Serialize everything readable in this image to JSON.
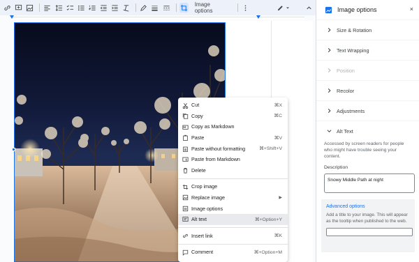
{
  "toolbar": {
    "icons": [
      "link-icon",
      "comment-add-icon",
      "image-icon",
      "align-left-icon",
      "line-spacing-icon",
      "checklist-icon",
      "bullet-list-icon",
      "numbered-list-icon",
      "decrease-indent-icon",
      "increase-indent-icon",
      "clear-format-icon",
      "pen-color-icon",
      "border-weight-icon",
      "border-dash-icon",
      "crop-icon",
      "more-icon",
      "edit-mode-icon",
      "collapse-icon"
    ],
    "image_options_label": "Image options"
  },
  "context_menu": {
    "groups": [
      [
        {
          "label": "Cut",
          "shortcut": "⌘X",
          "icon": "scissors-icon"
        },
        {
          "label": "Copy",
          "shortcut": "⌘C",
          "icon": "copy-icon"
        },
        {
          "label": "Copy as Markdown",
          "shortcut": "",
          "icon": "copy-markdown-icon"
        },
        {
          "label": "Paste",
          "shortcut": "⌘V",
          "icon": "paste-icon"
        },
        {
          "label": "Paste without formatting",
          "shortcut": "⌘+Shift+V",
          "icon": "paste-plain-icon"
        },
        {
          "label": "Paste from Markdown",
          "shortcut": "",
          "icon": "paste-markdown-icon"
        },
        {
          "label": "Delete",
          "shortcut": "",
          "icon": "trash-icon"
        }
      ],
      [
        {
          "label": "Crop image",
          "shortcut": "",
          "icon": "crop-icon"
        },
        {
          "label": "Replace image",
          "shortcut": "",
          "icon": "replace-image-icon",
          "submenu": true
        },
        {
          "label": "Image options",
          "shortcut": "",
          "icon": "image-options-icon"
        },
        {
          "label": "Alt text",
          "shortcut": "⌘+Option+Y",
          "icon": "alt-text-icon",
          "highlighted": true
        }
      ],
      [
        {
          "label": "Insert link",
          "shortcut": "⌘K",
          "icon": "link-icon"
        }
      ],
      [
        {
          "label": "Comment",
          "shortcut": "⌘+Option+M",
          "icon": "comment-icon"
        }
      ]
    ]
  },
  "sidebar": {
    "title": "Image options",
    "close": "×",
    "sections": [
      {
        "label": "Size & Rotation",
        "disabled": false
      },
      {
        "label": "Text Wrapping",
        "disabled": false
      },
      {
        "label": "Position",
        "disabled": true
      },
      {
        "label": "Recolor",
        "disabled": false
      },
      {
        "label": "Adjustments",
        "disabled": false
      },
      {
        "label": "Alt Text",
        "disabled": false,
        "expanded": true
      }
    ],
    "alt_text": {
      "help": "Accessed by screen readers for people who might have trouble seeing your content.",
      "description_label": "Description",
      "description_value": "Snowy Middle Path at night",
      "advanced_title": "Advanced options",
      "advanced_text": "Add a title to your image. This will appear as the tooltip when published to the web.",
      "title_value": ""
    }
  },
  "colors": {
    "accent": "#1a73e8",
    "toolbar_bg": "#edf2fa",
    "menu_highlight": "#e8eaed"
  }
}
